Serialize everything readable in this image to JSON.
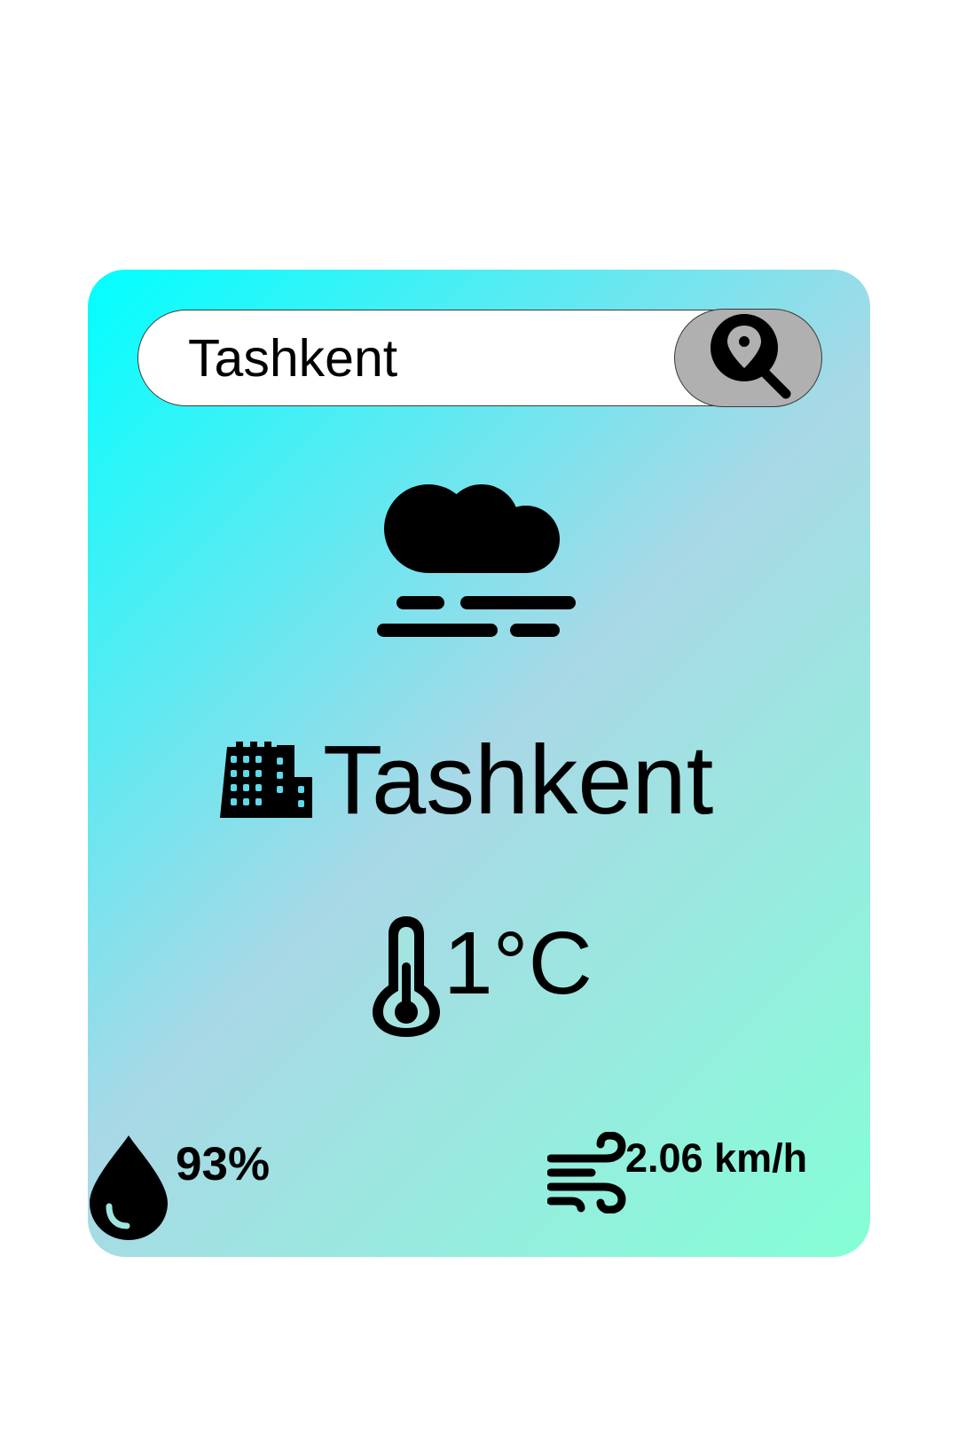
{
  "search": {
    "value": "Tashkent",
    "button_icon": "location-search-icon"
  },
  "weather": {
    "condition_icon": "cloud-fog-icon",
    "city_icon": "city-buildings-icon",
    "city": "Tashkent",
    "temperature_icon": "thermometer-icon",
    "temperature": "1°C",
    "humidity_icon": "water-drop-icon",
    "humidity": "93%",
    "wind_icon": "wind-icon",
    "wind_speed": "2.06 km/h"
  },
  "colors": {
    "gradient_start": "#00ffff",
    "gradient_mid": "#a9d8e6",
    "gradient_end": "#84ffd6",
    "search_button_bg": "#b0b0b0"
  }
}
